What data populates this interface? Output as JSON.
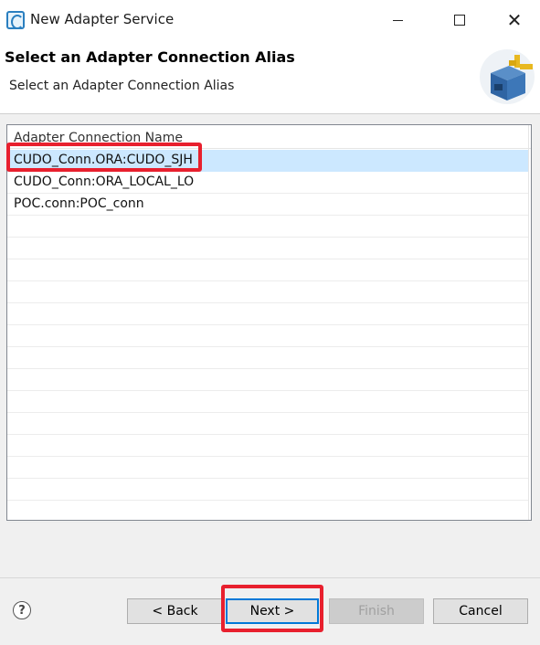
{
  "window": {
    "title": "New Adapter Service",
    "minimize_label": "",
    "maximize_label": "",
    "close_glyph": "✕"
  },
  "header": {
    "title": "Select an Adapter Connection Alias",
    "description": "Select an Adapter Connection Alias"
  },
  "table": {
    "column_header": "Adapter Connection Name",
    "rows": [
      "CUDO_Conn.ORA:CUDO_SJH",
      "CUDO_Conn:ORA_LOCAL_LO",
      "POC.conn:POC_conn"
    ],
    "selected_index": 0
  },
  "footer": {
    "help_glyph": "?",
    "back_label": "< Back",
    "next_label": "Next >",
    "finish_label": "Finish",
    "cancel_label": "Cancel"
  },
  "colors": {
    "selection": "#cce8ff",
    "highlight": "#e8202e",
    "default_button_border": "#0078d7"
  }
}
